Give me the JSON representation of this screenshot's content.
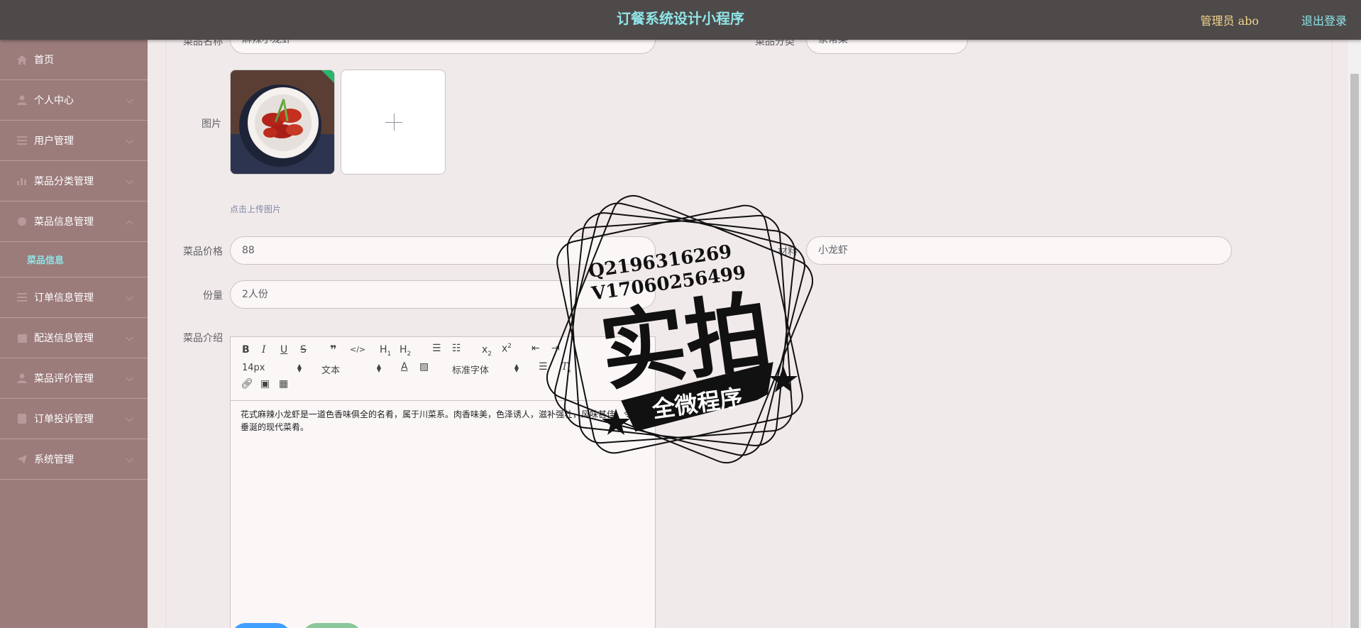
{
  "header": {
    "title": "订餐系统设计小程序",
    "user": "管理员 abo",
    "logout": "退出登录"
  },
  "sidebar": {
    "items": [
      {
        "label": "首页",
        "icon": "home-icon",
        "arrow": false
      },
      {
        "label": "个人中心",
        "icon": "user-icon",
        "arrow": true
      },
      {
        "label": "用户管理",
        "icon": "list-icon",
        "arrow": true
      },
      {
        "label": "菜品分类管理",
        "icon": "chart-icon",
        "arrow": true
      },
      {
        "label": "菜品信息管理",
        "icon": "goods-icon",
        "arrow": true,
        "expanded": true
      },
      {
        "label": "订单信息管理",
        "icon": "list-icon",
        "arrow": true
      },
      {
        "label": "配送信息管理",
        "icon": "calendar-icon",
        "arrow": true
      },
      {
        "label": "菜品评价管理",
        "icon": "user-icon",
        "arrow": true
      },
      {
        "label": "订单投诉管理",
        "icon": "document-icon",
        "arrow": true
      },
      {
        "label": "系统管理",
        "icon": "send-icon",
        "arrow": true
      }
    ],
    "subitem": "菜品信息"
  },
  "form": {
    "name_label": "菜品名称",
    "name_value": "麻辣小龙虾",
    "category_label": "菜品分类",
    "category_value": "家常菜",
    "image_label": "图片",
    "upload_hint": "点击上传图片",
    "price_label": "菜品价格",
    "price_value": "88",
    "material_label": "材料",
    "material_value": "小龙虾",
    "portion_label": "份量",
    "portion_value": "2人份",
    "intro_label": "菜品介绍"
  },
  "editor": {
    "font_size": "14px",
    "heading": "文本",
    "font_family": "标准字体",
    "content": "花式麻辣小龙虾是一道色香味俱全的名肴，属于川菜系。肉香味美，色泽诱人，滋补强壮，风味甚佳，令人垂涎的现代菜肴。"
  },
  "watermark": {
    "line1": "Q2196316269",
    "line2": "V17060256499",
    "main": "实拍",
    "ribbon": "全微程序"
  }
}
